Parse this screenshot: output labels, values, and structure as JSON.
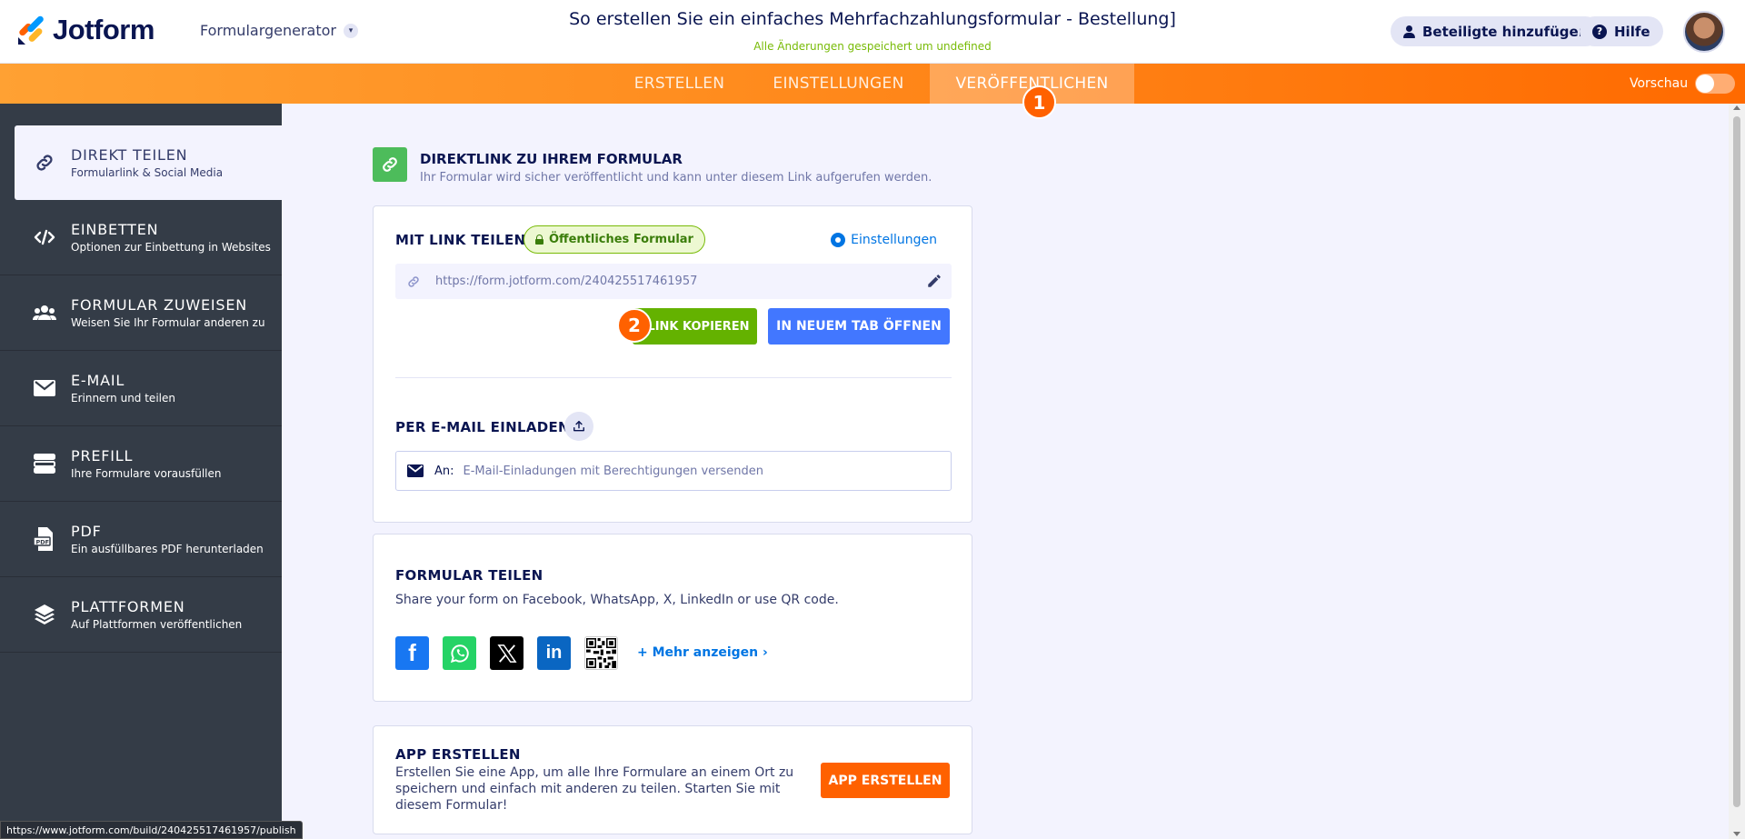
{
  "header": {
    "logo_text": "Jotform",
    "form_generator_label": "Formulargenerator",
    "form_title": "So erstellen Sie ein einfaches Mehrfachzahlungsformular - Bestellung]",
    "saved_status": "Alle Änderungen gespeichert um undefined",
    "add_participants_label": "Beteiligte hinzufügen",
    "help_label": "Hilfe"
  },
  "nav": {
    "tabs": [
      {
        "label": "ERSTELLEN"
      },
      {
        "label": "EINSTELLUNGEN"
      },
      {
        "label": "VERÖFFENTLICHEN"
      }
    ],
    "step_badge_1": "1",
    "preview_label": "Vorschau"
  },
  "sidebar": {
    "items": [
      {
        "title": "DIREKT TEILEN",
        "sub": "Formularlink & Social Media"
      },
      {
        "title": "EINBETTEN",
        "sub": "Optionen zur Einbettung in Websites"
      },
      {
        "title": "FORMULAR ZUWEISEN",
        "sub": "Weisen Sie Ihr Formular anderen zu"
      },
      {
        "title": "E-MAIL",
        "sub": "Erinnern und teilen"
      },
      {
        "title": "PREFILL",
        "sub": "Ihre Formulare vorausfüllen"
      },
      {
        "title": "PDF",
        "sub": "Ein ausfüllbares PDF herunterladen"
      },
      {
        "title": "PLATTFORMEN",
        "sub": "Auf Plattformen veröffentlichen"
      }
    ]
  },
  "direct_link": {
    "title": "DIREKTLINK ZU IHREM FORMULAR",
    "subtitle": "Ihr Formular wird sicher veröffentlicht und kann unter diesem Link aufgerufen werden."
  },
  "share_link": {
    "label": "MIT LINK TEILEN",
    "public_badge": "Öffentliches Formular",
    "settings_label": "Einstellungen",
    "url": "https://form.jotform.com/240425517461957",
    "copy_button": "LINK KOPIEREN",
    "step_badge_2": "2",
    "new_tab_button": "IN NEUEM TAB ÖFFNEN",
    "email_invite_label": "PER E-MAIL EINLADEN",
    "email_to_label": "An:",
    "email_placeholder": "E-Mail-Einladungen mit Berechtigungen versenden"
  },
  "share_form": {
    "title": "FORMULAR TEILEN",
    "subtitle": "Share your form on Facebook, WhatsApp, X, LinkedIn or use QR code.",
    "more_label": "Mehr anzeigen",
    "icons": [
      "facebook-icon",
      "whatsapp-icon",
      "x-icon",
      "linkedin-icon",
      "qr-code-icon"
    ]
  },
  "app": {
    "title": "APP ERSTELLEN",
    "description": "Erstellen Sie eine App, um alle Ihre Formulare an einem Ort zu speichern und einfach mit anderen zu teilen. Starten Sie mit diesem Formular!",
    "button": "APP ERSTELLEN"
  },
  "status_bar": {
    "url": "https://www.jotform.com/build/240425517461957/publish"
  },
  "colors": {
    "accent_orange": "#ff6100",
    "green": "#64b200",
    "blue": "#4277ff",
    "sidebar_bg": "#343c47"
  }
}
